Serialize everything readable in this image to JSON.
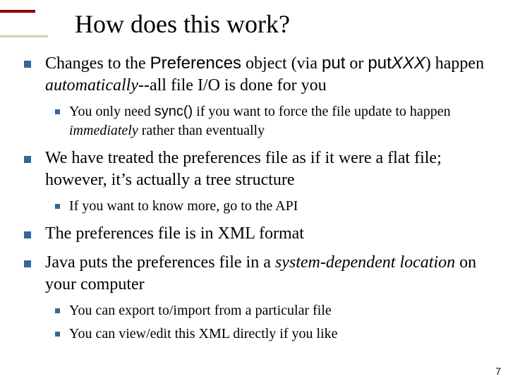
{
  "title": "How does this work?",
  "bullets": {
    "b1": {
      "pre": "Changes to the ",
      "code1": "Preferences",
      "mid1": " object (via ",
      "code2": "put",
      "mid2": " or ",
      "code3": "put",
      "code3ital": "XXX",
      "post": ") happen ",
      "ital": "automatically",
      "tail": "--all file I/O is done for you",
      "sub1": {
        "pre": "You only need ",
        "code": "sync()",
        "mid": " if you want to force the file update to happen ",
        "ital": "immediately",
        "tail": " rather than eventually"
      }
    },
    "b2": {
      "text": "We have treated the preferences file as if it were a flat file; however, it’s actually a tree structure",
      "sub1": "If you want to know more, go to the API"
    },
    "b3": "The preferences file is in XML format",
    "b4": {
      "pre": "Java puts the preferences file in a ",
      "ital": "system-dependent location",
      "tail": " on your computer",
      "sub1": "You can export to/import from a particular file",
      "sub2": "You can view/edit this XML directly if you like"
    }
  },
  "page": "7"
}
